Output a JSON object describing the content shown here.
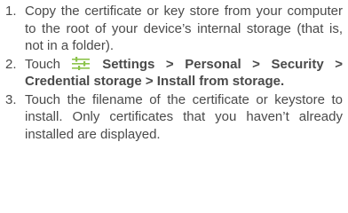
{
  "steps": [
    {
      "number": "1.",
      "text": "Copy the certificate or key store from your computer to the root of your device’s internal storage (that is, not in a folder)."
    },
    {
      "number": "2.",
      "prefix": "Touch",
      "icon": "settings-sliders-icon",
      "icon_color": "#8bc34a",
      "path": "Settings > Personal > Security > Credential storage > Install from storage."
    },
    {
      "number": "3.",
      "text": "Touch the filename of the certificate or keystore to install. Only certificates that you haven’t already installed are displayed."
    }
  ]
}
